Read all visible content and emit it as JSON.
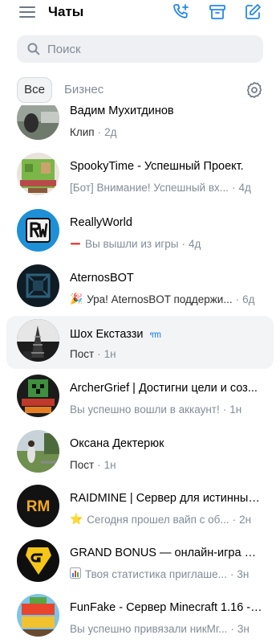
{
  "header": {
    "title": "Чаты"
  },
  "search": {
    "placeholder": "Поиск"
  },
  "tabs": [
    {
      "label": "Все"
    },
    {
      "label": "Бизнес"
    }
  ],
  "chats": [
    {
      "name": "Вадим Мухитдинов",
      "preview": "Клип",
      "time": "2д",
      "avatar": "photo-landscape"
    },
    {
      "name": "SpookyTime - Успешный Проект.",
      "preview": "[Бот] Внимание! Успешный вх...",
      "time": "4д",
      "avatar": "spookytime-logo"
    },
    {
      "name": "ReallyWorld",
      "preview": "Вы вышли из игры",
      "time": "4д",
      "icon": "minus-icon",
      "avatar": "reallyworld-logo"
    },
    {
      "name": "AternosBOT",
      "preview": "Ура! AternosBOT поддержи...",
      "time": "6д",
      "icon": "party-icon",
      "avatar": "aternos-logo"
    },
    {
      "name": "Шох Екстаззи",
      "preview": "Пост",
      "time": "1н",
      "badge": "ꦟ",
      "avatar": "photo-tower"
    },
    {
      "name": "ArcherGrief | Достигни цели и соз...",
      "preview": "Вы успешно вошли в аккаунт!",
      "time": "1н",
      "avatar": "archergrief-logo"
    },
    {
      "name": "Оксана Дектерюк",
      "preview": "Пост",
      "time": "1н",
      "avatar": "photo-park"
    },
    {
      "name": "RAIDMINE | Сервер для истинных ...",
      "preview": "Сегодня прошел вайп с об...",
      "time": "2н",
      "icon": "star-icon",
      "avatar": "raidmine-logo"
    },
    {
      "name": "GRAND BONUS — онлайн-игра на ...",
      "preview": "Твоя статистика приглаше...",
      "time": "3н",
      "icon": "chart-icon",
      "avatar": "grandbonus-logo"
    },
    {
      "name": "FunFake - Сервер Minecraft 1.16 - ...",
      "preview": "Вы успешно привязали никМг...",
      "time": "3н",
      "avatar": "funfake-logo"
    }
  ],
  "colors": {
    "accent": "#2688eb",
    "text_secondary": "#818c99",
    "active_row": "#f3f4f6"
  }
}
